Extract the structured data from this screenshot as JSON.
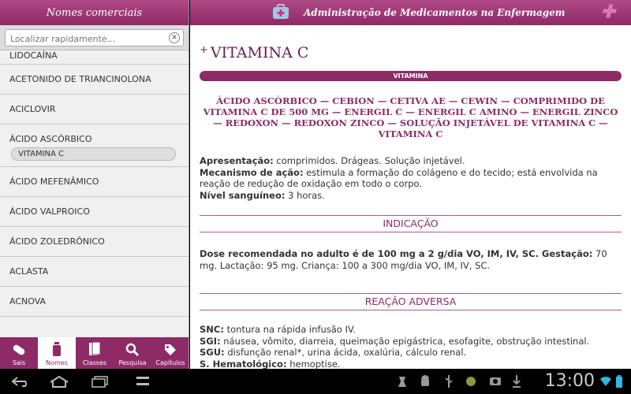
{
  "left_header": "Nomes comerciais",
  "search": {
    "placeholder": "Localizar rapidamente..."
  },
  "list": [
    "LIDOCAÍNA",
    "ACETONIDO DE TRIANCINOLONA",
    "ACICLOVIR",
    "ÁCIDO ASCÓRBICO",
    "ÁCIDO MEFENÂMICO",
    "ÁCIDO VALPROICO",
    "ÁCIDO ZOLEDRÔNICO",
    "ACLASTA",
    "ACNOVA"
  ],
  "selected_sub": "VITAMINA C",
  "tabs": [
    {
      "label": "Sais",
      "icon": "pill-icon"
    },
    {
      "label": "Nomes",
      "icon": "bottle-icon"
    },
    {
      "label": "Classes",
      "icon": "books-icon"
    },
    {
      "label": "Pesquisa",
      "icon": "search-icon"
    },
    {
      "label": "Capítulos",
      "icon": "tags-icon"
    }
  ],
  "right_header": "Administração de Medicamentos na Enfermagem",
  "drug": {
    "title": "VITAMINA C",
    "class": "VITAMINA",
    "synonyms": "ÁCIDO ASCÓRBICO — CEBION — CETIVA AE — CEWIN — COMPRIMIDO DE VITAMINA C DE 500 MG — ENERGIL C — ENERGIL C AMINO — ENERGIL ZINCO — REDOXON — REDOXON ZINCO — SOLUÇÃO INJETÁVEL DE VITAMINA C — VITAMINA C",
    "presentation_label": "Apresentação:",
    "presentation": " comprimidos. Drágeas. Solução injetável.",
    "mechanism_label": "Mecanismo de ação:",
    "mechanism": " estimula a formação do colágeno e do tecido; está envolvida na reação de redução de oxidação em todo o corpo.",
    "level_label": "Nível sanguíneo:",
    "level": " 3 horas.",
    "indication_title": "INDICAÇÃO",
    "dose_label": "Dose recomendada no adulto é de 100 mg a 2 g/dia VO, IM, IV, SC. Gestação:",
    "dose": " 70 mg. Lactação: 95 mg. Criança: 100 a 300 mg/dia VO, IM, IV, SC.",
    "adverse_title": "REAÇÃO ADVERSA",
    "snc_label": "SNC:",
    "snc": " tontura na rápida infusão IV.",
    "sgi_label": "SGI:",
    "sgi": " náusea, vômito, diarreia, queimação epigástrica, esofagite, obstrução intestinal.",
    "sgu_label": "SGU:",
    "sgu": " disfunção renal*, urina ácida, oxalúria, cálculo renal.",
    "hem_label": "S. Hematológico:",
    "hem": " hemoptise."
  },
  "clock": "13:00",
  "colors": {
    "accent": "#8e2a66",
    "accent_light": "#b04a86"
  }
}
